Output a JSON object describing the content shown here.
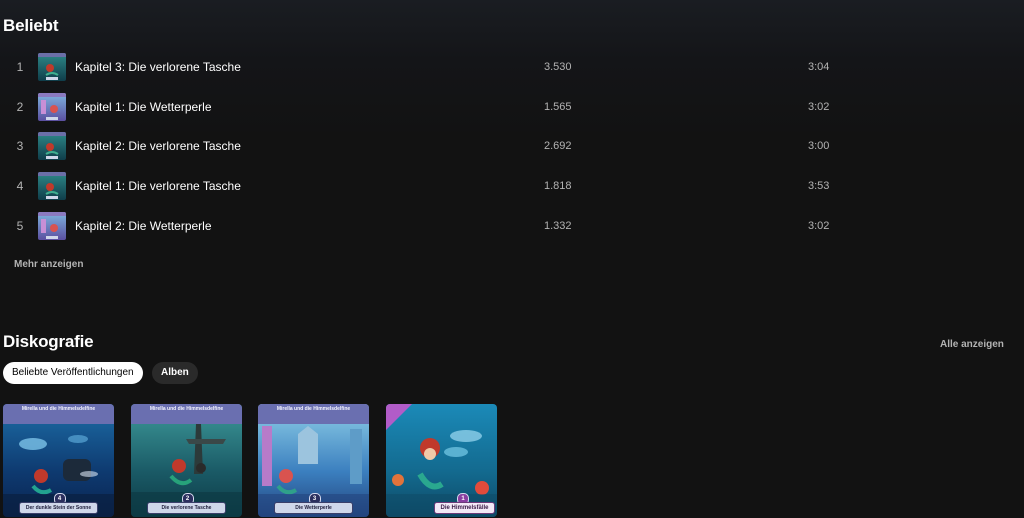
{
  "popular": {
    "title": "Beliebt",
    "tracks": [
      {
        "num": "1",
        "title": "Kapitel 3: Die verlorene Tasche",
        "plays": "3.530",
        "duration": "3:04",
        "cover": "tasche"
      },
      {
        "num": "2",
        "title": "Kapitel 1: Die Wetterperle",
        "plays": "1.565",
        "duration": "3:02",
        "cover": "perle"
      },
      {
        "num": "3",
        "title": "Kapitel 2: Die verlorene Tasche",
        "plays": "2.692",
        "duration": "3:00",
        "cover": "tasche"
      },
      {
        "num": "4",
        "title": "Kapitel 1: Die verlorene Tasche",
        "plays": "1.818",
        "duration": "3:53",
        "cover": "tasche"
      },
      {
        "num": "5",
        "title": "Kapitel 2: Die Wetterperle",
        "plays": "1.332",
        "duration": "3:02",
        "cover": "perle"
      }
    ],
    "show_more": "Mehr anzeigen"
  },
  "discography": {
    "title": "Diskografie",
    "show_all": "Alle anzeigen",
    "filters": [
      {
        "label": "Beliebte Veröffentlichungen",
        "active": true
      },
      {
        "label": "Alben",
        "active": false
      }
    ],
    "albums": [
      {
        "series_line": "Mirella und die Himmelsdelfine",
        "label": "Der dunkle Stein der Sonne",
        "number": "4"
      },
      {
        "series_line": "Mirella und die Himmelsdelfine",
        "label": "Die verlorene Tasche",
        "number": "2"
      },
      {
        "series_line": "Mirella und die Himmelsdelfine",
        "label": "Die Wetterperle",
        "number": "3"
      },
      {
        "series_line": "",
        "label": "Die Himmelsfälle",
        "number": "1"
      }
    ]
  },
  "colors": {
    "background": "#121212",
    "text_primary": "#ffffff",
    "text_secondary": "#b3b3b3",
    "chip_active_bg": "#ffffff",
    "chip_inactive_bg": "#2a2a2a"
  }
}
